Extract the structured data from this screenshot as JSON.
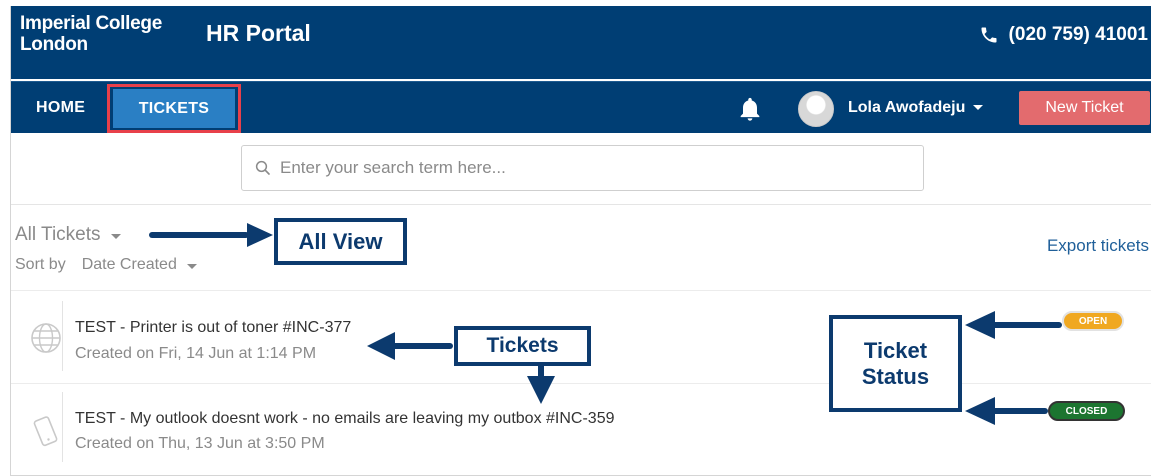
{
  "header": {
    "logo_line1": "Imperial College",
    "logo_line2": "London",
    "portal_title": "HR Portal",
    "phone": "(020 759) 41001"
  },
  "nav": {
    "home": "HOME",
    "tickets": "TICKETS",
    "user_name": "Lola Awofadeju",
    "new_ticket": "New Ticket"
  },
  "search": {
    "placeholder": "Enter your search term here..."
  },
  "list": {
    "view": "All Tickets",
    "sort_label": "Sort by",
    "sort_value": "Date Created",
    "export": "Export tickets"
  },
  "tickets": [
    {
      "title": "TEST - Printer is out of toner #INC-377",
      "meta": "Created on Fri, 14 Jun at 1:14 PM",
      "status": "OPEN",
      "icon": "globe-icon"
    },
    {
      "title": "TEST - My outlook doesnt work - no emails are leaving my outbox #INC-359",
      "meta": "Created on Thu, 13 Jun at 3:50 PM",
      "status": "CLOSED",
      "icon": "mobile-icon"
    }
  ],
  "annotations": {
    "all_view": "All View",
    "tickets": "Tickets",
    "status_line1": "Ticket",
    "status_line2": "Status"
  },
  "colors": {
    "navy": "#003e74",
    "tickets_tab": "#2a7fc4",
    "highlight": "#e8404a",
    "new_ticket": "#e36b6e",
    "open": "#f0a821",
    "closed": "#1c7530",
    "annotation": "#0c3a6e"
  }
}
